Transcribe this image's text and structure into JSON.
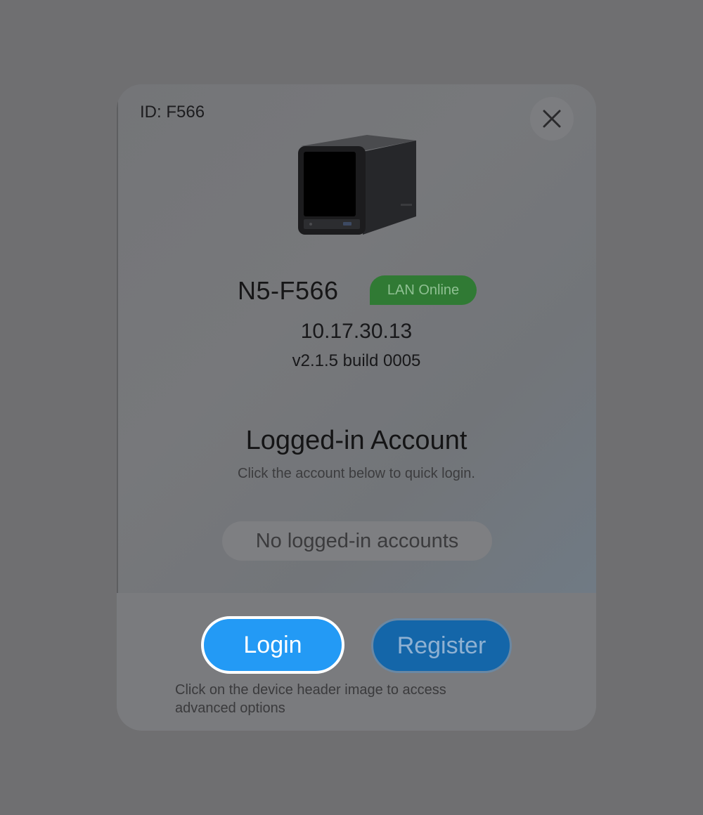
{
  "header": {
    "id_label": "ID: F566",
    "close_icon": "close-icon"
  },
  "device": {
    "image_icon": "nas-device-image",
    "name": "N5-F566",
    "status_badge": "LAN Online",
    "status_color": "#307a34",
    "ip": "10.17.30.13",
    "firmware": "v2.1.5 build 0005"
  },
  "accounts": {
    "title": "Logged-in Account",
    "subtitle": "Click the account below to quick login.",
    "empty_text": "No logged-in accounts"
  },
  "actions": {
    "login_label": "Login",
    "login_color": "#239af5",
    "register_label": "Register",
    "register_color": "#1466a9"
  },
  "footer": {
    "hint": "Click on the device header image to access advanced options"
  }
}
